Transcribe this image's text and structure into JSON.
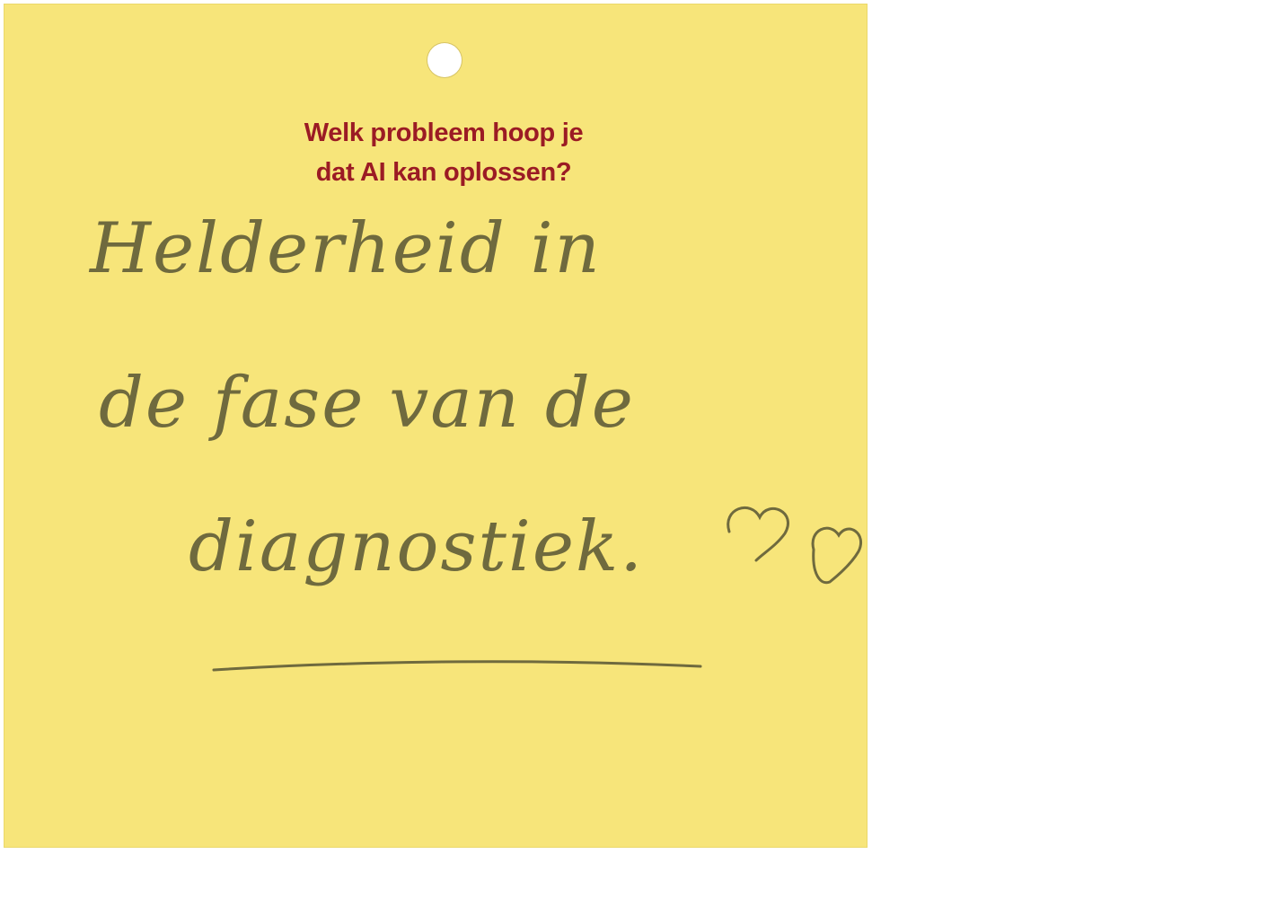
{
  "card": {
    "question_line_1": "Welk probleem hoop je",
    "question_line_2": "dat AI kan oplossen?"
  },
  "answer": {
    "line_1": "Helderheid in",
    "line_2": "de fase van de",
    "line_3": "diagnostiek."
  },
  "colors": {
    "card": "#f7e57a",
    "question_text": "#9b1b24",
    "ink": "#6f6a3e"
  },
  "icons": [
    "hearts-doodle-icon",
    "underline-stroke"
  ]
}
